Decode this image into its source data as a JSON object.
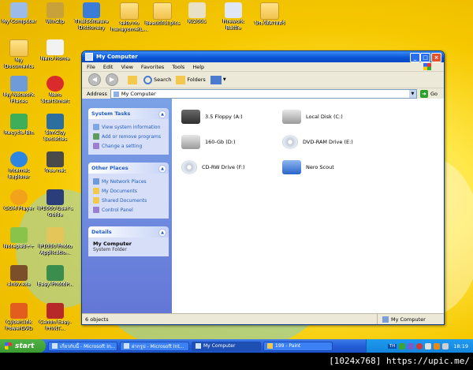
{
  "desktop": {
    "icons": [
      {
        "label": "My Computer"
      },
      {
        "label": "WinZip"
      },
      {
        "label": "ThaiSoftware Dictionary"
      },
      {
        "label": "seto no hanayome(L..."
      },
      {
        "label": "Beautiful pics"
      },
      {
        "label": "KI2005"
      },
      {
        "label": "Firework Battle"
      },
      {
        "label": "ประวัติศาสตร์"
      },
      {
        "label": "My Documents"
      },
      {
        "label": "Nero Home"
      },
      {
        "label": "My Network Places"
      },
      {
        "label": "Nero StartSmart"
      },
      {
        "label": "Recycle Bin"
      },
      {
        "label": "SimCity Societies"
      },
      {
        "label": "Internet Explorer"
      },
      {
        "label": "free net"
      },
      {
        "label": "GOM Player"
      },
      {
        "label": "iP1000 User's Guide"
      },
      {
        "label": "Notepad++"
      },
      {
        "label": "iP1000 Photo Applicatio..."
      },
      {
        "label": "ahdv.exe"
      },
      {
        "label": "Easy-PhotoP..."
      },
      {
        "label": "CyberLink PowerDVD"
      },
      {
        "label": "Canon Easy-PrintT..."
      }
    ]
  },
  "window": {
    "title": "My Computer",
    "menu": [
      "File",
      "Edit",
      "View",
      "Favorites",
      "Tools",
      "Help"
    ],
    "toolbar": {
      "search": "Search",
      "folders": "Folders"
    },
    "address": {
      "label": "Address",
      "value": "My Computer",
      "go": "Go"
    },
    "tasks": {
      "system_tasks": {
        "title": "System Tasks",
        "items": [
          "View system information",
          "Add or remove programs",
          "Change a setting"
        ]
      },
      "other_places": {
        "title": "Other Places",
        "items": [
          "My Network Places",
          "My Documents",
          "Shared Documents",
          "Control Panel"
        ]
      },
      "details": {
        "title": "Details",
        "name": "My Computer",
        "desc": "System Folder"
      }
    },
    "drives": [
      {
        "label": "3.5 Floppy (A:)",
        "icon": "floppy-icon"
      },
      {
        "label": "Local Disk (C:)",
        "icon": "hard-disk-icon"
      },
      {
        "label": "160-Gb (D:)",
        "icon": "hard-disk-icon"
      },
      {
        "label": "DVD-RAM Drive (E:)",
        "icon": "dvd-drive-icon"
      },
      {
        "label": "CD-RW Drive (F:)",
        "icon": "cd-drive-icon"
      },
      {
        "label": "Nero Scout",
        "icon": "nero-scout-icon"
      }
    ],
    "status": {
      "count": "6 objects",
      "location": "My Computer"
    }
  },
  "taskbar": {
    "start": "start",
    "tasks": [
      {
        "label": "เกี่ยวกับนี้ - Microsoft In..."
      },
      {
        "label": "ฝากรูป - Microsoft Int..."
      },
      {
        "label": "My Computer"
      },
      {
        "label": "199 - Paint"
      }
    ],
    "tray_lang": "TH",
    "clock": "18:19"
  },
  "caption": "[1024x768] https://upic.me/"
}
